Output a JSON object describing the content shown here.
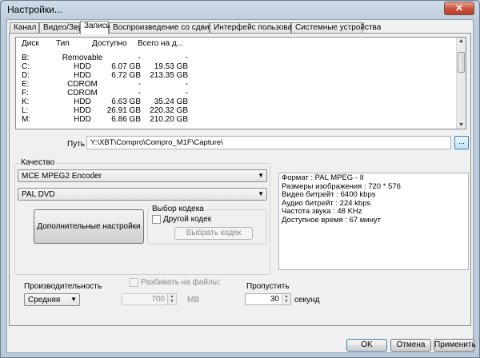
{
  "window": {
    "title": "Настройки...",
    "close_label": "✕"
  },
  "tabs": [
    {
      "label": "Канал",
      "active": false
    },
    {
      "label": "Видео/Звук",
      "active": false
    },
    {
      "label": "Запись",
      "active": true
    },
    {
      "label": "Воспроизведение со сдвигом",
      "active": false
    },
    {
      "label": "Интерфейс пользователя",
      "active": false
    },
    {
      "label": "Системные устройства",
      "active": false
    }
  ],
  "disk_list": {
    "headers": [
      "Диск",
      "Тип",
      "Доступно",
      "Всего на д..."
    ],
    "rows": [
      [
        "B:",
        "Removable",
        "-",
        "-"
      ],
      [
        "C:",
        "HDD",
        "6.07 GB",
        "19.53 GB"
      ],
      [
        "D:",
        "HDD",
        "6.72 GB",
        "213.35 GB"
      ],
      [
        "E:",
        "CDROM",
        "-",
        "-"
      ],
      [
        "F:",
        "CDROM",
        "-",
        "-"
      ],
      [
        "K:",
        "HDD",
        "6.63 GB",
        "35.24 GB"
      ],
      [
        "L:",
        "HDD",
        "26.91 GB",
        "220.32 GB"
      ],
      [
        "M:",
        "HDD",
        "6.86 GB",
        "210.20 GB"
      ]
    ]
  },
  "path": {
    "label": "Путь",
    "value": "Y:\\XBT\\Compro\\Compro_M1F\\Capture\\",
    "browse_label": "..."
  },
  "quality": {
    "legend": "Качество",
    "encoder": "MCE MPEG2 Encoder",
    "profile": "PAL DVD",
    "advanced_button": "Дополнительные настройки",
    "codec_group": "Выбор кодека",
    "other_codec_label": "Другой кодек",
    "choose_codec_button": "Выбрать кодек"
  },
  "info": [
    "Формат : PAL MPEG - II",
    "Размеры изображения : 720 * 576",
    "Видео битрейт : 6400 kbps",
    "Аудио битрейт : 224 kbps",
    "Частота звука : 48 KHz",
    "Доступное время : 67 минут"
  ],
  "performance": {
    "label": "Производительность",
    "value": "Средняя"
  },
  "split": {
    "label": "Разбивать на файлы:",
    "value": "700",
    "unit": "MB"
  },
  "skip": {
    "label": "Пропустить",
    "value": "30",
    "unit": "секунд"
  },
  "buttons": {
    "ok": "OK",
    "cancel": "Отмена",
    "apply": "Применить"
  }
}
